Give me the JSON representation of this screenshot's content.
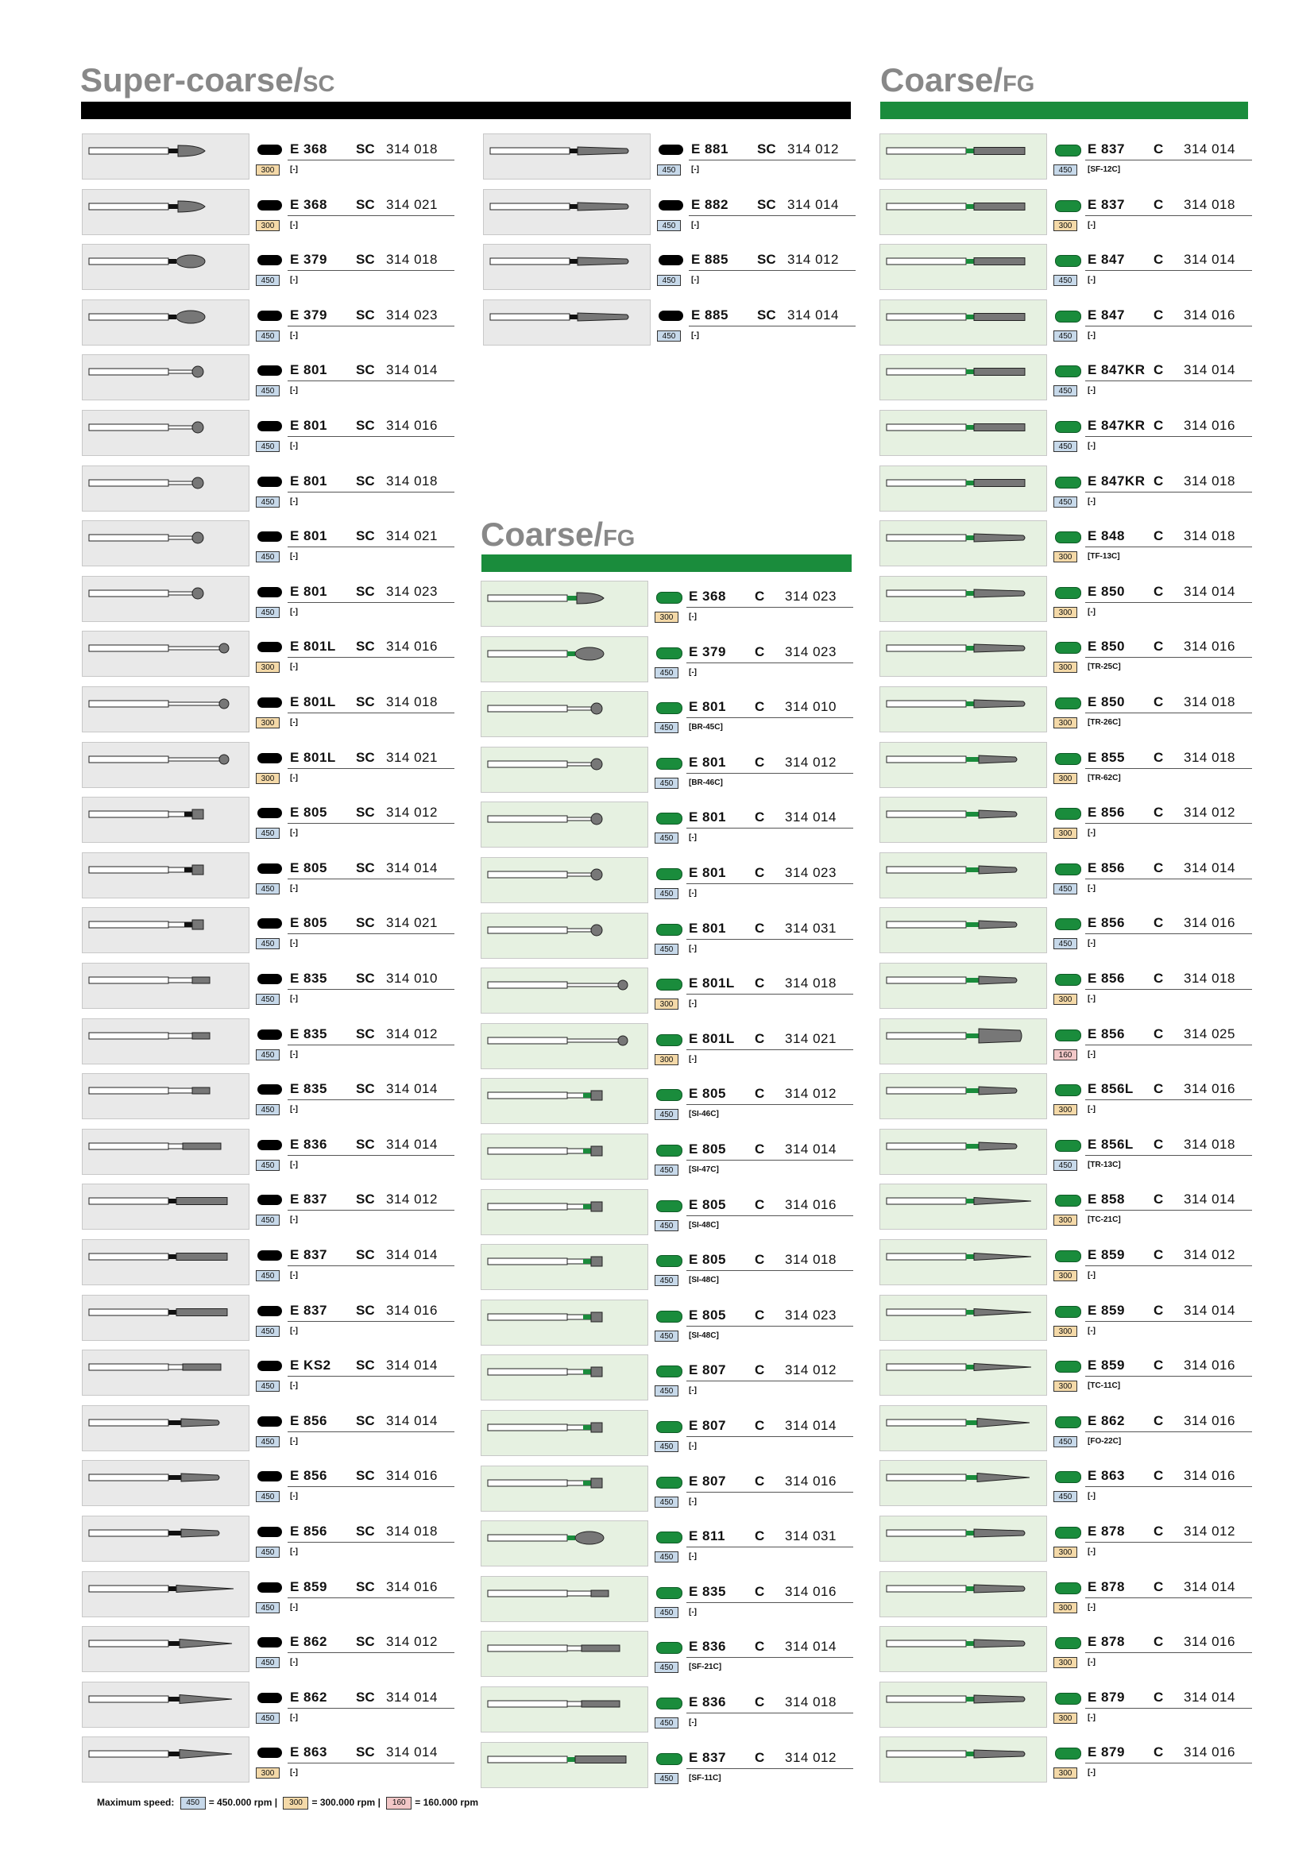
{
  "headers": {
    "sc": {
      "main": "Super-coarse/",
      "sub": "SC"
    },
    "c_top": {
      "main": "Coarse/",
      "sub": "FG"
    },
    "c_mid": {
      "main": "Coarse/",
      "sub": "FG"
    }
  },
  "colors": {
    "sc_bar": "#000000",
    "c_bar": "#1a8c3c",
    "sc_thumb_bg": "#e9e9e9",
    "c_thumb_bg": "#e6f1e1",
    "green_dot": "#1a8c3c"
  },
  "sc_col1": [
    {
      "code": "E 368",
      "grade": "SC",
      "num": "314 018",
      "speed": "300",
      "ref": "[-]",
      "shape": "flame"
    },
    {
      "code": "E 368",
      "grade": "SC",
      "num": "314 021",
      "speed": "300",
      "ref": "[-]",
      "shape": "flame"
    },
    {
      "code": "E 379",
      "grade": "SC",
      "num": "314 018",
      "speed": "450",
      "ref": "[-]",
      "shape": "egg"
    },
    {
      "code": "E 379",
      "grade": "SC",
      "num": "314 023",
      "speed": "450",
      "ref": "[-]",
      "shape": "egg"
    },
    {
      "code": "E 801",
      "grade": "SC",
      "num": "314 014",
      "speed": "450",
      "ref": "[-]",
      "shape": "ball"
    },
    {
      "code": "E 801",
      "grade": "SC",
      "num": "314 016",
      "speed": "450",
      "ref": "[-]",
      "shape": "ball"
    },
    {
      "code": "E 801",
      "grade": "SC",
      "num": "314 018",
      "speed": "450",
      "ref": "[-]",
      "shape": "ball"
    },
    {
      "code": "E 801",
      "grade": "SC",
      "num": "314 021",
      "speed": "450",
      "ref": "[-]",
      "shape": "ball"
    },
    {
      "code": "E 801",
      "grade": "SC",
      "num": "314 023",
      "speed": "450",
      "ref": "[-]",
      "shape": "ball"
    },
    {
      "code": "E 801L",
      "grade": "SC",
      "num": "314 016",
      "speed": "300",
      "ref": "[-]",
      "shape": "ball-long"
    },
    {
      "code": "E 801L",
      "grade": "SC",
      "num": "314 018",
      "speed": "300",
      "ref": "[-]",
      "shape": "ball-long"
    },
    {
      "code": "E 801L",
      "grade": "SC",
      "num": "314 021",
      "speed": "300",
      "ref": "[-]",
      "shape": "ball-long"
    },
    {
      "code": "E 805",
      "grade": "SC",
      "num": "314 012",
      "speed": "450",
      "ref": "[-]",
      "shape": "cone"
    },
    {
      "code": "E 805",
      "grade": "SC",
      "num": "314 014",
      "speed": "450",
      "ref": "[-]",
      "shape": "cone"
    },
    {
      "code": "E 805",
      "grade": "SC",
      "num": "314 021",
      "speed": "450",
      "ref": "[-]",
      "shape": "cone"
    },
    {
      "code": "E 835",
      "grade": "SC",
      "num": "314 010",
      "speed": "450",
      "ref": "[-]",
      "shape": "cyl-short"
    },
    {
      "code": "E 835",
      "grade": "SC",
      "num": "314 012",
      "speed": "450",
      "ref": "[-]",
      "shape": "cyl-short"
    },
    {
      "code": "E 835",
      "grade": "SC",
      "num": "314 014",
      "speed": "450",
      "ref": "[-]",
      "shape": "cyl-short"
    },
    {
      "code": "E 836",
      "grade": "SC",
      "num": "314 014",
      "speed": "450",
      "ref": "[-]",
      "shape": "cyl"
    },
    {
      "code": "E 837",
      "grade": "SC",
      "num": "314 012",
      "speed": "450",
      "ref": "[-]",
      "shape": "cyl-long"
    },
    {
      "code": "E 837",
      "grade": "SC",
      "num": "314 014",
      "speed": "450",
      "ref": "[-]",
      "shape": "cyl-long"
    },
    {
      "code": "E 837",
      "grade": "SC",
      "num": "314 016",
      "speed": "450",
      "ref": "[-]",
      "shape": "cyl-long"
    },
    {
      "code": "E KS2",
      "grade": "SC",
      "num": "314 014",
      "speed": "450",
      "ref": "[-]",
      "shape": "cyl"
    },
    {
      "code": "E 856",
      "grade": "SC",
      "num": "314 014",
      "speed": "450",
      "ref": "[-]",
      "shape": "taper"
    },
    {
      "code": "E 856",
      "grade": "SC",
      "num": "314 016",
      "speed": "450",
      "ref": "[-]",
      "shape": "taper"
    },
    {
      "code": "E 856",
      "grade": "SC",
      "num": "314 018",
      "speed": "450",
      "ref": "[-]",
      "shape": "taper"
    },
    {
      "code": "E 859",
      "grade": "SC",
      "num": "314 016",
      "speed": "450",
      "ref": "[-]",
      "shape": "needle"
    },
    {
      "code": "E 862",
      "grade": "SC",
      "num": "314 012",
      "speed": "450",
      "ref": "[-]",
      "shape": "flame-long"
    },
    {
      "code": "E 862",
      "grade": "SC",
      "num": "314 014",
      "speed": "450",
      "ref": "[-]",
      "shape": "flame-long"
    },
    {
      "code": "E 863",
      "grade": "SC",
      "num": "314 014",
      "speed": "300",
      "ref": "[-]",
      "shape": "flame-long"
    }
  ],
  "sc_col2": [
    {
      "code": "E 881",
      "grade": "SC",
      "num": "314 012",
      "speed": "450",
      "ref": "[-]",
      "shape": "taper-long"
    },
    {
      "code": "E 882",
      "grade": "SC",
      "num": "314 014",
      "speed": "450",
      "ref": "[-]",
      "shape": "taper-long"
    },
    {
      "code": "E 885",
      "grade": "SC",
      "num": "314 012",
      "speed": "450",
      "ref": "[-]",
      "shape": "taper-long"
    },
    {
      "code": "E 885",
      "grade": "SC",
      "num": "314 014",
      "speed": "450",
      "ref": "[-]",
      "shape": "taper-long"
    }
  ],
  "c_col2": [
    {
      "code": "E 368",
      "grade": "C",
      "num": "314 023",
      "speed": "300",
      "ref": "[-]",
      "shape": "flame"
    },
    {
      "code": "E 379",
      "grade": "C",
      "num": "314 023",
      "speed": "450",
      "ref": "[-]",
      "shape": "egg"
    },
    {
      "code": "E 801",
      "grade": "C",
      "num": "314 010",
      "speed": "450",
      "ref": "[BR-45C]",
      "shape": "ball"
    },
    {
      "code": "E 801",
      "grade": "C",
      "num": "314 012",
      "speed": "450",
      "ref": "[BR-46C]",
      "shape": "ball"
    },
    {
      "code": "E 801",
      "grade": "C",
      "num": "314 014",
      "speed": "450",
      "ref": "[-]",
      "shape": "ball"
    },
    {
      "code": "E 801",
      "grade": "C",
      "num": "314 023",
      "speed": "450",
      "ref": "[-]",
      "shape": "ball"
    },
    {
      "code": "E 801",
      "grade": "C",
      "num": "314 031",
      "speed": "450",
      "ref": "[-]",
      "shape": "ball"
    },
    {
      "code": "E 801L",
      "grade": "C",
      "num": "314 018",
      "speed": "300",
      "ref": "[-]",
      "shape": "ball-long"
    },
    {
      "code": "E 801L",
      "grade": "C",
      "num": "314 021",
      "speed": "300",
      "ref": "[-]",
      "shape": "ball-long"
    },
    {
      "code": "E 805",
      "grade": "C",
      "num": "314 012",
      "speed": "450",
      "ref": "[SI-46C]",
      "shape": "cone"
    },
    {
      "code": "E 805",
      "grade": "C",
      "num": "314 014",
      "speed": "450",
      "ref": "[SI-47C]",
      "shape": "cone"
    },
    {
      "code": "E 805",
      "grade": "C",
      "num": "314 016",
      "speed": "450",
      "ref": "[SI-48C]",
      "shape": "cone"
    },
    {
      "code": "E 805",
      "grade": "C",
      "num": "314 018",
      "speed": "450",
      "ref": "[SI-48C]",
      "shape": "cone"
    },
    {
      "code": "E 805",
      "grade": "C",
      "num": "314 023",
      "speed": "450",
      "ref": "[SI-48C]",
      "shape": "cone"
    },
    {
      "code": "E 807",
      "grade": "C",
      "num": "314 012",
      "speed": "450",
      "ref": "[-]",
      "shape": "cone"
    },
    {
      "code": "E 807",
      "grade": "C",
      "num": "314 014",
      "speed": "450",
      "ref": "[-]",
      "shape": "cone"
    },
    {
      "code": "E 807",
      "grade": "C",
      "num": "314 016",
      "speed": "450",
      "ref": "[-]",
      "shape": "cone"
    },
    {
      "code": "E 811",
      "grade": "C",
      "num": "314 031",
      "speed": "450",
      "ref": "[-]",
      "shape": "egg"
    },
    {
      "code": "E 835",
      "grade": "C",
      "num": "314 016",
      "speed": "450",
      "ref": "[-]",
      "shape": "cyl-short"
    },
    {
      "code": "E 836",
      "grade": "C",
      "num": "314 014",
      "speed": "450",
      "ref": "[SF-21C]",
      "shape": "cyl"
    },
    {
      "code": "E 836",
      "grade": "C",
      "num": "314 018",
      "speed": "450",
      "ref": "[-]",
      "shape": "cyl"
    },
    {
      "code": "E 837",
      "grade": "C",
      "num": "314 012",
      "speed": "450",
      "ref": "[SF-11C]",
      "shape": "cyl-long"
    }
  ],
  "c_col3": [
    {
      "code": "E 837",
      "grade": "C",
      "num": "314 014",
      "speed": "450",
      "ref": "[SF-12C]",
      "shape": "cyl-long"
    },
    {
      "code": "E 837",
      "grade": "C",
      "num": "314 018",
      "speed": "300",
      "ref": "[-]",
      "shape": "cyl-long"
    },
    {
      "code": "E 847",
      "grade": "C",
      "num": "314 014",
      "speed": "450",
      "ref": "[-]",
      "shape": "cyl-long"
    },
    {
      "code": "E 847",
      "grade": "C",
      "num": "314 016",
      "speed": "450",
      "ref": "[-]",
      "shape": "cyl-long"
    },
    {
      "code": "E 847KR",
      "grade": "C",
      "num": "314 014",
      "speed": "450",
      "ref": "[-]",
      "shape": "cyl-long"
    },
    {
      "code": "E 847KR",
      "grade": "C",
      "num": "314 016",
      "speed": "450",
      "ref": "[-]",
      "shape": "cyl-long"
    },
    {
      "code": "E 847KR",
      "grade": "C",
      "num": "314 018",
      "speed": "450",
      "ref": "[-]",
      "shape": "cyl-long"
    },
    {
      "code": "E 848",
      "grade": "C",
      "num": "314 018",
      "speed": "300",
      "ref": "[TF-13C]",
      "shape": "taper-long"
    },
    {
      "code": "E 850",
      "grade": "C",
      "num": "314 014",
      "speed": "300",
      "ref": "[-]",
      "shape": "taper-long"
    },
    {
      "code": "E 850",
      "grade": "C",
      "num": "314 016",
      "speed": "300",
      "ref": "[TR-25C]",
      "shape": "taper-long"
    },
    {
      "code": "E 850",
      "grade": "C",
      "num": "314 018",
      "speed": "300",
      "ref": "[TR-26C]",
      "shape": "taper-long"
    },
    {
      "code": "E 855",
      "grade": "C",
      "num": "314 018",
      "speed": "300",
      "ref": "[TR-62C]",
      "shape": "taper"
    },
    {
      "code": "E 856",
      "grade": "C",
      "num": "314 012",
      "speed": "300",
      "ref": "[-]",
      "shape": "taper"
    },
    {
      "code": "E 856",
      "grade": "C",
      "num": "314 014",
      "speed": "450",
      "ref": "[-]",
      "shape": "taper"
    },
    {
      "code": "E 856",
      "grade": "C",
      "num": "314 016",
      "speed": "450",
      "ref": "[-]",
      "shape": "taper"
    },
    {
      "code": "E 856",
      "grade": "C",
      "num": "314 018",
      "speed": "300",
      "ref": "[-]",
      "shape": "taper"
    },
    {
      "code": "E 856",
      "grade": "C",
      "num": "314 025",
      "speed": "160",
      "ref": "[-]",
      "shape": "taper-wide"
    },
    {
      "code": "E 856L",
      "grade": "C",
      "num": "314 016",
      "speed": "300",
      "ref": "[-]",
      "shape": "taper"
    },
    {
      "code": "E 856L",
      "grade": "C",
      "num": "314 018",
      "speed": "450",
      "ref": "[TR-13C]",
      "shape": "taper"
    },
    {
      "code": "E 858",
      "grade": "C",
      "num": "314 014",
      "speed": "300",
      "ref": "[TC-21C]",
      "shape": "needle"
    },
    {
      "code": "E 859",
      "grade": "C",
      "num": "314 012",
      "speed": "300",
      "ref": "[-]",
      "shape": "needle"
    },
    {
      "code": "E 859",
      "grade": "C",
      "num": "314 014",
      "speed": "300",
      "ref": "[-]",
      "shape": "needle"
    },
    {
      "code": "E 859",
      "grade": "C",
      "num": "314 016",
      "speed": "300",
      "ref": "[TC-11C]",
      "shape": "needle"
    },
    {
      "code": "E 862",
      "grade": "C",
      "num": "314 016",
      "speed": "450",
      "ref": "[FO-22C]",
      "shape": "flame-long"
    },
    {
      "code": "E 863",
      "grade": "C",
      "num": "314 016",
      "speed": "450",
      "ref": "[-]",
      "shape": "flame-long"
    },
    {
      "code": "E 878",
      "grade": "C",
      "num": "314 012",
      "speed": "300",
      "ref": "[-]",
      "shape": "taper-long"
    },
    {
      "code": "E 878",
      "grade": "C",
      "num": "314 014",
      "speed": "300",
      "ref": "[-]",
      "shape": "taper-long"
    },
    {
      "code": "E 878",
      "grade": "C",
      "num": "314 016",
      "speed": "300",
      "ref": "[-]",
      "shape": "taper-long"
    },
    {
      "code": "E 879",
      "grade": "C",
      "num": "314 014",
      "speed": "300",
      "ref": "[-]",
      "shape": "taper-long"
    },
    {
      "code": "E 879",
      "grade": "C",
      "num": "314 016",
      "speed": "300",
      "ref": "[-]",
      "shape": "taper-long"
    }
  ],
  "legend": {
    "label": "Maximum speed:",
    "items": [
      {
        "box": "450",
        "text": "= 450.000 rpm"
      },
      {
        "box": "300",
        "text": "= 300.000 rpm"
      },
      {
        "box": "160",
        "text": "= 160.000 rpm"
      }
    ],
    "sep": "|"
  }
}
